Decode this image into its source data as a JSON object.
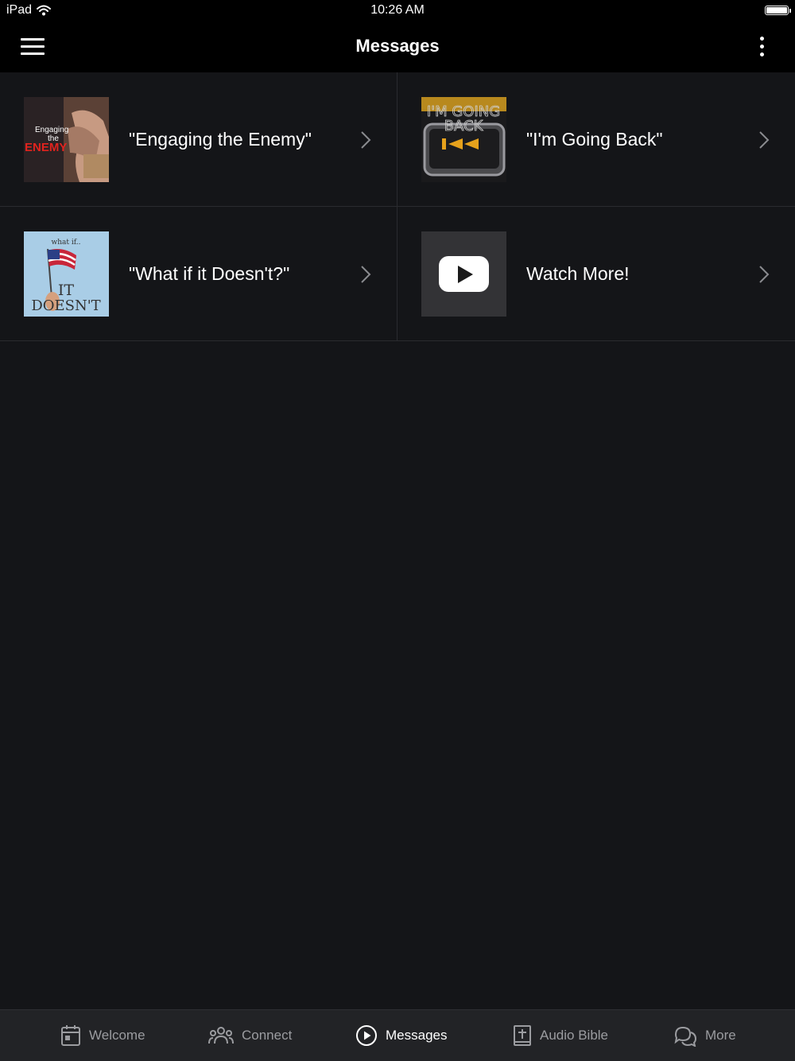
{
  "status_bar": {
    "device": "iPad",
    "time": "10:26 AM"
  },
  "nav": {
    "title": "Messages",
    "menu_icon": "hamburger-menu-icon",
    "more_icon": "vertical-dots-icon"
  },
  "items": [
    {
      "label": "\"Engaging the Enemy\"",
      "thumb_lines": [
        "Engaging",
        "the",
        "ENEMY"
      ]
    },
    {
      "label": "\"I'm Going Back\"",
      "thumb_lines": [
        "I'M GOING",
        "BACK"
      ]
    },
    {
      "label": "\"What if it Doesn't?\"",
      "thumb_lines": [
        "what if..",
        "IT",
        "DOESN'T"
      ]
    },
    {
      "label": "Watch More!"
    }
  ],
  "tabs": [
    {
      "label": "Welcome",
      "icon": "calendar-icon",
      "active": false
    },
    {
      "label": "Connect",
      "icon": "people-icon",
      "active": false
    },
    {
      "label": "Messages",
      "icon": "play-circle-icon",
      "active": true
    },
    {
      "label": "Audio Bible",
      "icon": "bible-icon",
      "active": false
    },
    {
      "label": "More",
      "icon": "chat-bubbles-icon",
      "active": false
    }
  ],
  "colors": {
    "background": "#141518",
    "bar": "#000000",
    "tabbar": "#222326",
    "inactive_tab": "#9b9ca0",
    "accent_red": "#e0231e"
  }
}
